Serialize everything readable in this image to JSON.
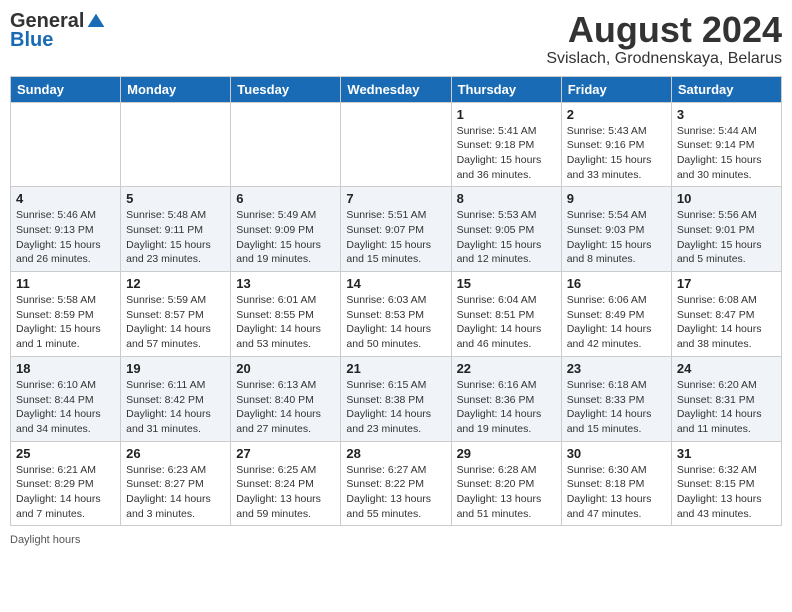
{
  "header": {
    "logo_general": "General",
    "logo_blue": "Blue",
    "month_title": "August 2024",
    "location": "Svislach, Grodnenskaya, Belarus"
  },
  "days_of_week": [
    "Sunday",
    "Monday",
    "Tuesday",
    "Wednesday",
    "Thursday",
    "Friday",
    "Saturday"
  ],
  "weeks": [
    [
      {
        "num": "",
        "detail": ""
      },
      {
        "num": "",
        "detail": ""
      },
      {
        "num": "",
        "detail": ""
      },
      {
        "num": "",
        "detail": ""
      },
      {
        "num": "1",
        "detail": "Sunrise: 5:41 AM\nSunset: 9:18 PM\nDaylight: 15 hours\nand 36 minutes."
      },
      {
        "num": "2",
        "detail": "Sunrise: 5:43 AM\nSunset: 9:16 PM\nDaylight: 15 hours\nand 33 minutes."
      },
      {
        "num": "3",
        "detail": "Sunrise: 5:44 AM\nSunset: 9:14 PM\nDaylight: 15 hours\nand 30 minutes."
      }
    ],
    [
      {
        "num": "4",
        "detail": "Sunrise: 5:46 AM\nSunset: 9:13 PM\nDaylight: 15 hours\nand 26 minutes."
      },
      {
        "num": "5",
        "detail": "Sunrise: 5:48 AM\nSunset: 9:11 PM\nDaylight: 15 hours\nand 23 minutes."
      },
      {
        "num": "6",
        "detail": "Sunrise: 5:49 AM\nSunset: 9:09 PM\nDaylight: 15 hours\nand 19 minutes."
      },
      {
        "num": "7",
        "detail": "Sunrise: 5:51 AM\nSunset: 9:07 PM\nDaylight: 15 hours\nand 15 minutes."
      },
      {
        "num": "8",
        "detail": "Sunrise: 5:53 AM\nSunset: 9:05 PM\nDaylight: 15 hours\nand 12 minutes."
      },
      {
        "num": "9",
        "detail": "Sunrise: 5:54 AM\nSunset: 9:03 PM\nDaylight: 15 hours\nand 8 minutes."
      },
      {
        "num": "10",
        "detail": "Sunrise: 5:56 AM\nSunset: 9:01 PM\nDaylight: 15 hours\nand 5 minutes."
      }
    ],
    [
      {
        "num": "11",
        "detail": "Sunrise: 5:58 AM\nSunset: 8:59 PM\nDaylight: 15 hours\nand 1 minute."
      },
      {
        "num": "12",
        "detail": "Sunrise: 5:59 AM\nSunset: 8:57 PM\nDaylight: 14 hours\nand 57 minutes."
      },
      {
        "num": "13",
        "detail": "Sunrise: 6:01 AM\nSunset: 8:55 PM\nDaylight: 14 hours\nand 53 minutes."
      },
      {
        "num": "14",
        "detail": "Sunrise: 6:03 AM\nSunset: 8:53 PM\nDaylight: 14 hours\nand 50 minutes."
      },
      {
        "num": "15",
        "detail": "Sunrise: 6:04 AM\nSunset: 8:51 PM\nDaylight: 14 hours\nand 46 minutes."
      },
      {
        "num": "16",
        "detail": "Sunrise: 6:06 AM\nSunset: 8:49 PM\nDaylight: 14 hours\nand 42 minutes."
      },
      {
        "num": "17",
        "detail": "Sunrise: 6:08 AM\nSunset: 8:47 PM\nDaylight: 14 hours\nand 38 minutes."
      }
    ],
    [
      {
        "num": "18",
        "detail": "Sunrise: 6:10 AM\nSunset: 8:44 PM\nDaylight: 14 hours\nand 34 minutes."
      },
      {
        "num": "19",
        "detail": "Sunrise: 6:11 AM\nSunset: 8:42 PM\nDaylight: 14 hours\nand 31 minutes."
      },
      {
        "num": "20",
        "detail": "Sunrise: 6:13 AM\nSunset: 8:40 PM\nDaylight: 14 hours\nand 27 minutes."
      },
      {
        "num": "21",
        "detail": "Sunrise: 6:15 AM\nSunset: 8:38 PM\nDaylight: 14 hours\nand 23 minutes."
      },
      {
        "num": "22",
        "detail": "Sunrise: 6:16 AM\nSunset: 8:36 PM\nDaylight: 14 hours\nand 19 minutes."
      },
      {
        "num": "23",
        "detail": "Sunrise: 6:18 AM\nSunset: 8:33 PM\nDaylight: 14 hours\nand 15 minutes."
      },
      {
        "num": "24",
        "detail": "Sunrise: 6:20 AM\nSunset: 8:31 PM\nDaylight: 14 hours\nand 11 minutes."
      }
    ],
    [
      {
        "num": "25",
        "detail": "Sunrise: 6:21 AM\nSunset: 8:29 PM\nDaylight: 14 hours\nand 7 minutes."
      },
      {
        "num": "26",
        "detail": "Sunrise: 6:23 AM\nSunset: 8:27 PM\nDaylight: 14 hours\nand 3 minutes."
      },
      {
        "num": "27",
        "detail": "Sunrise: 6:25 AM\nSunset: 8:24 PM\nDaylight: 13 hours\nand 59 minutes."
      },
      {
        "num": "28",
        "detail": "Sunrise: 6:27 AM\nSunset: 8:22 PM\nDaylight: 13 hours\nand 55 minutes."
      },
      {
        "num": "29",
        "detail": "Sunrise: 6:28 AM\nSunset: 8:20 PM\nDaylight: 13 hours\nand 51 minutes."
      },
      {
        "num": "30",
        "detail": "Sunrise: 6:30 AM\nSunset: 8:18 PM\nDaylight: 13 hours\nand 47 minutes."
      },
      {
        "num": "31",
        "detail": "Sunrise: 6:32 AM\nSunset: 8:15 PM\nDaylight: 13 hours\nand 43 minutes."
      }
    ]
  ],
  "footer": {
    "daylight_label": "Daylight hours"
  }
}
